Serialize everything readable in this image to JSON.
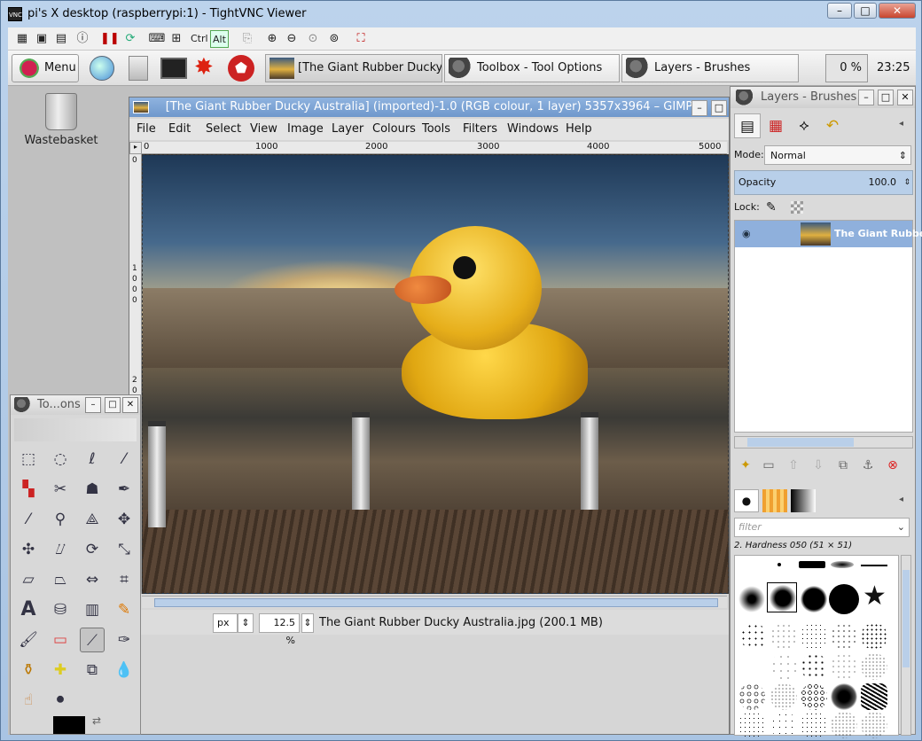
{
  "vnc": {
    "title": "pi's X desktop (raspberrypi:1) - TightVNC Viewer",
    "logo": "VNC",
    "toolbar": {
      "ctrl": "Ctrl",
      "alt": "Alt"
    },
    "buttons": {
      "minimize": "–",
      "maximize": "□",
      "close": "✕"
    }
  },
  "panel": {
    "menu_label": "Menu",
    "tasks": [
      {
        "label": "[The Giant Rubber Ducky A..."
      },
      {
        "label": "Toolbox - Tool Options"
      },
      {
        "label": "Layers - Brushes"
      }
    ],
    "cpu": "0 %",
    "clock": "23:25"
  },
  "desktop": {
    "wastebasket_label": "Wastebasket"
  },
  "gimp_window": {
    "title": "[The Giant Rubber Ducky Australia] (imported)-1.0 (RGB colour, 1 layer) 5357x3964 – GIMP",
    "menu": [
      "File",
      "Edit",
      "Select",
      "View",
      "Image",
      "Layer",
      "Colours",
      "Tools",
      "Filters",
      "Windows",
      "Help"
    ],
    "ruler_top": [
      "0",
      "1000",
      "2000",
      "3000",
      "4000",
      "5000"
    ],
    "ruler_left": [
      "0",
      "1",
      "0",
      "0",
      "0",
      "2",
      "0"
    ],
    "unit": "px",
    "zoom": "12.5 %",
    "status": "The Giant Rubber Ducky Australia.jpg (200.1 MB)"
  },
  "toolbox": {
    "title": "To...ons"
  },
  "layers_dock": {
    "title": "Layers - Brushes",
    "mode_label": "Mode:",
    "mode_value": "Normal",
    "opacity_label": "Opacity",
    "opacity_value": "100.0",
    "lock_label": "Lock:",
    "layer_name": "The Giant Rubber D",
    "filter_placeholder": "filter",
    "brush_name": "2. Hardness 050 (51 × 51)"
  }
}
